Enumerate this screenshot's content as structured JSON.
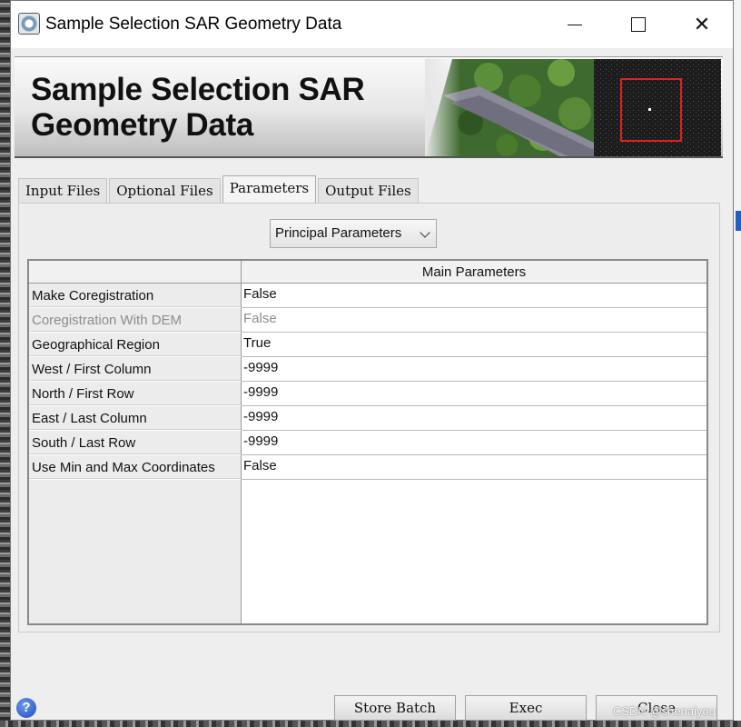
{
  "window": {
    "title": "Sample Selection SAR Geometry Data",
    "minimize_label": "",
    "maximize_label": "",
    "close_label": "✕"
  },
  "banner": {
    "title": "Sample Selection SAR\nGeometry Data"
  },
  "tabs": [
    {
      "label": "Input Files",
      "active": false
    },
    {
      "label": "Optional Files",
      "active": false
    },
    {
      "label": "Parameters",
      "active": true
    },
    {
      "label": "Output Files",
      "active": false
    }
  ],
  "parameters": {
    "group_selected": "Principal Parameters",
    "table_header": "Main Parameters",
    "rows": [
      {
        "label": "Make Coregistration",
        "value": "False",
        "enabled": true
      },
      {
        "label": "Coregistration With DEM",
        "value": "False",
        "enabled": false
      },
      {
        "label": "Geographical Region",
        "value": "True",
        "enabled": true
      },
      {
        "label": "West / First Column",
        "value": "-9999",
        "enabled": true
      },
      {
        "label": "North / First Row",
        "value": "-9999",
        "enabled": true
      },
      {
        "label": "East / Last Column",
        "value": "-9999",
        "enabled": true
      },
      {
        "label": "South / Last Row",
        "value": "-9999",
        "enabled": true
      },
      {
        "label": "Use Min and Max Coordinates",
        "value": "False",
        "enabled": true
      }
    ]
  },
  "footer": {
    "help_label": "?",
    "store_batch_label": "Store Batch",
    "exec_label": "Exec",
    "close_label": "Close",
    "watermark": "CSDN @shenaiyou"
  }
}
